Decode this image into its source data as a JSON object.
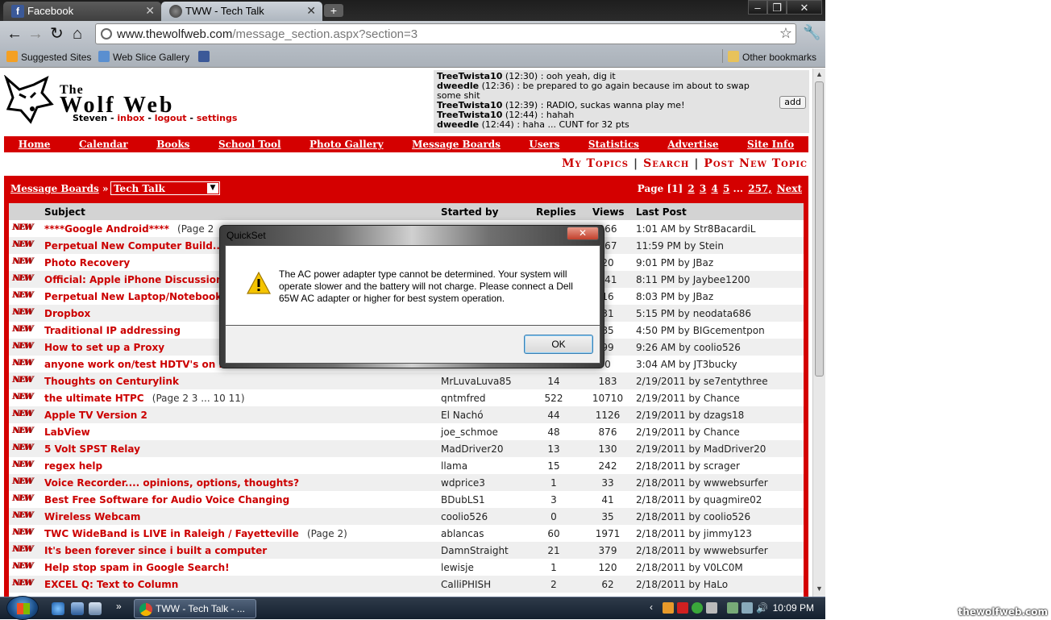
{
  "browser": {
    "tabs": [
      {
        "label": "Facebook",
        "active": false
      },
      {
        "label": "TWW - Tech Talk",
        "active": true
      }
    ],
    "url_host": "www.thewolfweb.com",
    "url_path": "/message_section.aspx?section=3",
    "bookmarks": [
      "Suggested Sites",
      "Web Slice Gallery"
    ],
    "other_bookmarks": "Other bookmarks"
  },
  "site": {
    "logo_the": "The",
    "logo_name": "Wolf Web",
    "user": "Steven",
    "user_links": [
      "inbox",
      "logout",
      "settings"
    ],
    "shouts": [
      {
        "user": "TreeTwista10",
        "time": "(12:30)",
        "text": " : ooh yeah, dig it"
      },
      {
        "user": "dweedle",
        "time": "(12:36)",
        "text": " : be prepared to go again because im about to swap some shit"
      },
      {
        "user": "TreeTwista10",
        "time": "(12:39)",
        "text": " : RADIO, suckas wanna play me!"
      },
      {
        "user": "TreeTwista10",
        "time": "(12:44)",
        "text": " : hahah"
      },
      {
        "user": "dweedle",
        "time": "(12:44)",
        "text": " : haha ... CUNT for 32 pts"
      }
    ],
    "shout_add": "add",
    "nav": [
      "Home",
      "Calendar",
      "Books",
      "School Tool",
      "Photo Gallery",
      "Message Boards",
      "Users",
      "Statistics",
      "Advertise",
      "Site Info"
    ],
    "topic_links": [
      "My Topics",
      "Search",
      "Post New Topic"
    ]
  },
  "board": {
    "crumb": "Message Boards",
    "crumb_sep": "»",
    "selected": "Tech Talk",
    "pager_prefix": "Page [1]",
    "pager_pages": [
      "2",
      "3",
      "4",
      "5",
      "...",
      "257,",
      "Next"
    ],
    "columns": [
      "Subject",
      "Started by",
      "Replies",
      "Views",
      "Last Post"
    ],
    "new_badge": "NEW",
    "rows": [
      {
        "subject": "****Google Android****",
        "pages": "(Page 2",
        "starter": "",
        "replies": "",
        "views": "266",
        "last": "1:01 AM by Str8BacardiL"
      },
      {
        "subject": "Perpetual New Computer Build...",
        "pages": "",
        "starter": "",
        "replies": "",
        "views": "567",
        "last": "11:59 PM by Stein"
      },
      {
        "subject": "Photo Recovery",
        "pages": "",
        "starter": "",
        "replies": "",
        "views": "20",
        "last": "9:01 PM by JBaz"
      },
      {
        "subject": "Official: Apple iPhone Discussion",
        "pages": "",
        "starter": "",
        "replies": "",
        "views": "641",
        "last": "8:11 PM by Jaybee1200"
      },
      {
        "subject": "Perpetual New Laptop/Notebook/",
        "pages": "",
        "starter": "",
        "replies": "",
        "views": "16",
        "last": "8:03 PM by JBaz"
      },
      {
        "subject": "Dropbox",
        "pages": "",
        "starter": "",
        "replies": "",
        "views": "31",
        "last": "5:15 PM by neodata686"
      },
      {
        "subject": "Traditional IP addressing",
        "pages": "",
        "starter": "",
        "replies": "",
        "views": "85",
        "last": "4:50 PM by BIGcementpon"
      },
      {
        "subject": "How to set up a Proxy",
        "pages": "",
        "starter": "",
        "replies": "",
        "views": "99",
        "last": "9:26 AM by coolio526"
      },
      {
        "subject": "anyone work on/test HDTV's on h",
        "pages": "",
        "starter": "",
        "replies": "",
        "views": "0",
        "last": "3:04 AM by JT3bucky"
      },
      {
        "subject": "Thoughts on Centurylink",
        "pages": "",
        "starter": "MrLuvaLuva85",
        "replies": "14",
        "views": "183",
        "last": "2/19/2011 by se7entythree"
      },
      {
        "subject": "the ultimate HTPC",
        "pages": "(Page 2 3 ... 10 11)",
        "starter": "qntmfred",
        "replies": "522",
        "views": "10710",
        "last": "2/19/2011 by Chance"
      },
      {
        "subject": "Apple TV Version 2",
        "pages": "",
        "starter": "El Nachó",
        "replies": "44",
        "views": "1126",
        "last": "2/19/2011 by dzags18"
      },
      {
        "subject": "LabView",
        "pages": "",
        "starter": "joe_schmoe",
        "replies": "48",
        "views": "876",
        "last": "2/19/2011 by Chance"
      },
      {
        "subject": "5 Volt SPST Relay",
        "pages": "",
        "starter": "MadDriver20",
        "replies": "13",
        "views": "130",
        "last": "2/19/2011 by MadDriver20"
      },
      {
        "subject": "regex help",
        "pages": "",
        "starter": "llama",
        "replies": "15",
        "views": "242",
        "last": "2/18/2011 by scrager"
      },
      {
        "subject": "Voice Recorder.... opinions, options, thoughts?",
        "pages": "",
        "starter": "wdprice3",
        "replies": "1",
        "views": "33",
        "last": "2/18/2011 by wwwebsurfer"
      },
      {
        "subject": "Best Free Software for Audio Voice Changing",
        "pages": "",
        "starter": "BDubLS1",
        "replies": "3",
        "views": "41",
        "last": "2/18/2011 by quagmire02"
      },
      {
        "subject": "Wireless Webcam",
        "pages": "",
        "starter": "coolio526",
        "replies": "0",
        "views": "35",
        "last": "2/18/2011 by coolio526"
      },
      {
        "subject": "TWC WideBand is LIVE in Raleigh / Fayetteville",
        "pages": "(Page 2)",
        "starter": "ablancas",
        "replies": "60",
        "views": "1971",
        "last": "2/18/2011 by jimmy123"
      },
      {
        "subject": "It's been forever since i built a computer",
        "pages": "",
        "starter": "DamnStraight",
        "replies": "21",
        "views": "379",
        "last": "2/18/2011 by wwwebsurfer"
      },
      {
        "subject": "Help stop spam in Google Search!",
        "pages": "",
        "starter": "lewisje",
        "replies": "1",
        "views": "120",
        "last": "2/18/2011 by V0LC0M"
      },
      {
        "subject": "EXCEL Q: Text to Column",
        "pages": "",
        "starter": "CalliPHISH",
        "replies": "2",
        "views": "62",
        "last": "2/18/2011 by HaLo"
      }
    ]
  },
  "dialog": {
    "title": "QuickSet",
    "message": "The AC power adapter type cannot be determined.  Your system will operate slower and the battery will not charge. Please connect a Dell 65W AC adapter or higher for best system operation.",
    "ok": "OK"
  },
  "taskbar": {
    "task": "TWW - Tech Talk - ...",
    "clock": "10:09 PM",
    "overflow": "»"
  },
  "watermark": "thewolfweb.com"
}
